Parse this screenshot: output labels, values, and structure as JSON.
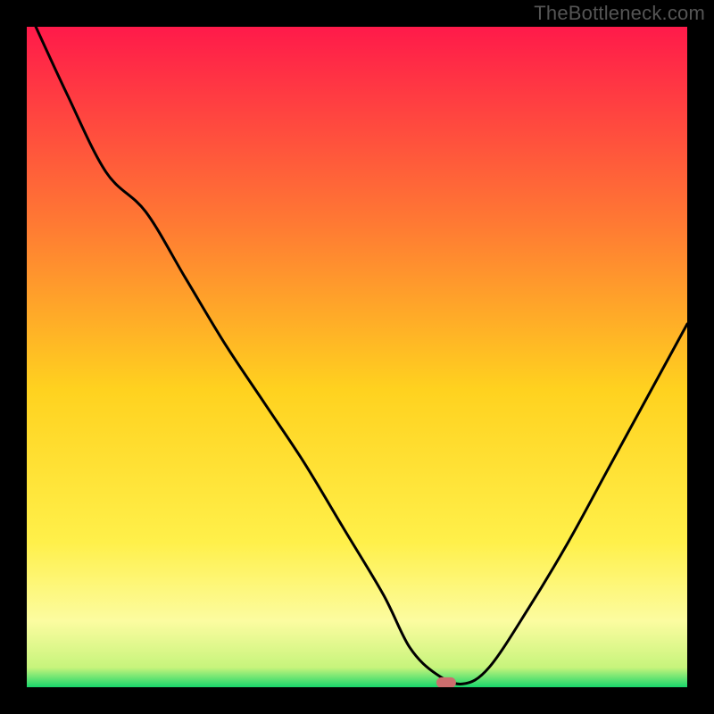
{
  "watermark": "TheBottleneck.com",
  "chart_data": {
    "type": "line",
    "title": "",
    "xlabel": "",
    "ylabel": "",
    "xlim": [
      0,
      100
    ],
    "ylim": [
      0,
      100
    ],
    "x": [
      0,
      6,
      12,
      18,
      24,
      30,
      36,
      42,
      48,
      54,
      58,
      62,
      66,
      70,
      76,
      82,
      88,
      94,
      100
    ],
    "values": [
      103,
      90,
      78,
      72,
      62,
      52,
      43,
      34,
      24,
      14,
      6,
      2,
      0.5,
      3,
      12,
      22,
      33,
      44,
      55
    ],
    "background_gradient_stops": [
      {
        "pct": 0,
        "color": "#ff1a4a"
      },
      {
        "pct": 30,
        "color": "#ff7a33"
      },
      {
        "pct": 55,
        "color": "#ffd21f"
      },
      {
        "pct": 78,
        "color": "#fff04a"
      },
      {
        "pct": 90,
        "color": "#fcfca0"
      },
      {
        "pct": 97,
        "color": "#c7f47c"
      },
      {
        "pct": 100,
        "color": "#18d66b"
      }
    ],
    "marker": {
      "x": 63.5,
      "y": 0.7,
      "color": "#cc6e6e"
    }
  }
}
